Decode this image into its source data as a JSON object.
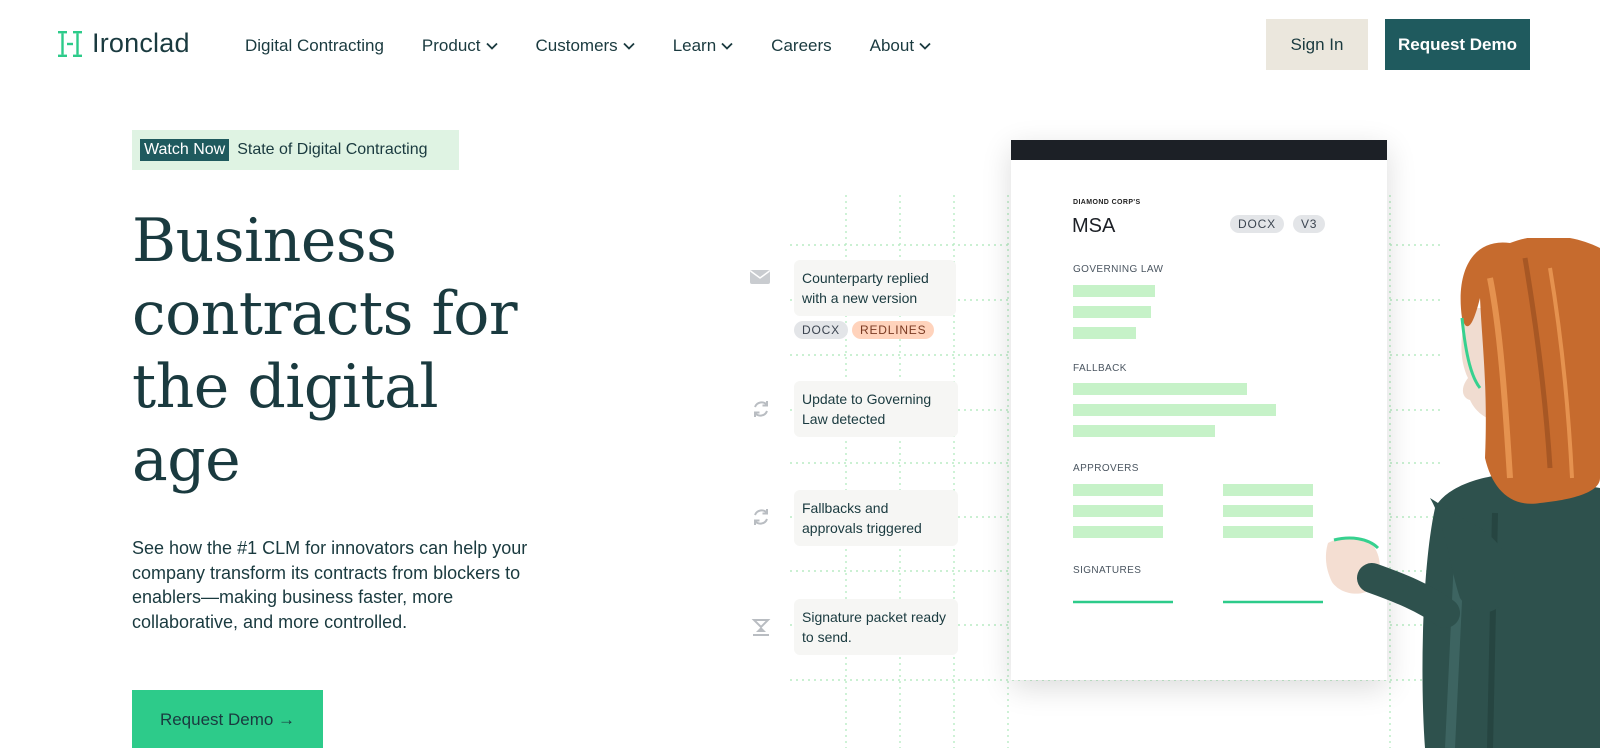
{
  "nav": {
    "logo_text": "Ironclad",
    "links": [
      {
        "label": "Digital Contracting",
        "has_menu": false
      },
      {
        "label": "Product",
        "has_menu": true
      },
      {
        "label": "Customers",
        "has_menu": true
      },
      {
        "label": "Learn",
        "has_menu": true
      },
      {
        "label": "Careers",
        "has_menu": false
      },
      {
        "label": "About",
        "has_menu": true
      }
    ],
    "sign_in": "Sign In",
    "request_demo": "Request Demo"
  },
  "hero": {
    "banner_tag": "Watch Now",
    "banner_text": "State of Digital Contracting",
    "headline": "Business contracts for the digital age",
    "subtext": "See how the #1 CLM for innovators can help your company transform its contracts from blockers to enablers—making business faster, more collaborative, and more controlled.",
    "cta": "Request Demo →"
  },
  "timeline": {
    "events": [
      {
        "icon": "mail-icon",
        "text": "Counterparty replied with a new version"
      },
      {
        "icon": "refresh-icon",
        "text": "Update to Governing Law detected"
      },
      {
        "icon": "refresh-icon",
        "text": "Fallbacks and approvals triggered"
      },
      {
        "icon": "signature-icon",
        "text": "Signature packet ready to send."
      }
    ],
    "tags": [
      "DOCX",
      "REDLINES"
    ]
  },
  "document": {
    "kicker": "DIAMOND CORP'S",
    "title": "MSA",
    "pills": [
      "DOCX",
      "V3"
    ],
    "sections": [
      "GOVERNING LAW",
      "FALLBACK",
      "APPROVERS",
      "SIGNATURES"
    ]
  },
  "colors": {
    "brand_dark": "#1f5a5e",
    "brand_green": "#2dcb8a",
    "highlight_green": "#c6f2c8",
    "text": "#1a3a3f"
  }
}
